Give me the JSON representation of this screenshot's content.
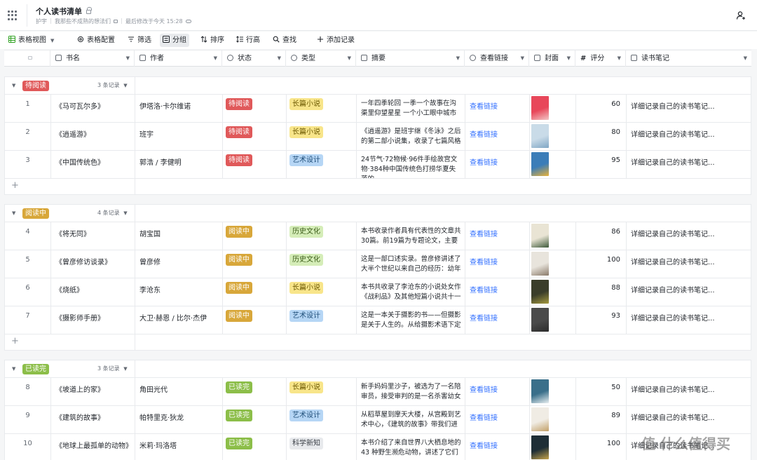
{
  "header": {
    "title": "个人读书清单",
    "owner": "护宇",
    "description": "我那些不成熟的想法们",
    "saved": "最后修改于今天 15:28"
  },
  "toolbar": {
    "view": "表格视图",
    "config": "表格配置",
    "filter": "筛选",
    "group": "分组",
    "sort": "排序",
    "row_height": "行高",
    "search": "查找",
    "add": "添加记录"
  },
  "columns": {
    "name": "书名",
    "author": "作者",
    "status": "状态",
    "type": "类型",
    "summary": "摘要",
    "link": "查看链接",
    "cover": "封面",
    "score": "评分",
    "notes": "读书笔记"
  },
  "groups": [
    {
      "label": "待阅读",
      "count": "3 条记录",
      "rows": [
        {
          "num": "1",
          "name": "《马可瓦尔多》",
          "author": "伊塔洛·卡尔维诺",
          "status": "待阅读",
          "type": "长篇小说",
          "summary": "一年四季轮回 一季一个故事在沟渠里仰望星星 一个小工眼中城市",
          "link": "查看链接",
          "score": "60",
          "notes": "详细记录自己的读书笔记..."
        },
        {
          "num": "2",
          "name": "《逍遥游》",
          "author": "班宇",
          "status": "待阅读",
          "type": "长篇小说",
          "summary": "《逍遥游》是班宇继《冬泳》之后的第二部小说集，收录了七篇风格",
          "link": "查看链接",
          "score": "80",
          "notes": "详细记录自己的读书笔记..."
        },
        {
          "num": "3",
          "name": "《中国传统色》",
          "author": "郭浩 / 李健明",
          "status": "待阅读",
          "type": "艺术设计",
          "summary": "24节气·72物候·96件手绘故宫文物·384种中国传统色打捞华夏失落的",
          "link": "查看链接",
          "score": "95",
          "notes": "详细记录自己的读书笔记..."
        }
      ]
    },
    {
      "label": "阅读中",
      "count": "4 条记录",
      "rows": [
        {
          "num": "4",
          "name": "《将无同》",
          "author": "胡宝国",
          "status": "阅读中",
          "type": "历史文化",
          "summary": "本书收录作者具有代表性的文章共30篇。前19篇为专题论文，主要",
          "link": "查看链接",
          "score": "86",
          "notes": "详细记录自己的读书笔记..."
        },
        {
          "num": "5",
          "name": "《曾彦修访谈录》",
          "author": "曾彦修",
          "status": "阅读中",
          "type": "历史文化",
          "summary": "这是一部口述实录。曾彦修讲述了大半个世纪以来自己的经历：幼年",
          "link": "查看链接",
          "score": "100",
          "notes": "详细记录自己的读书笔记..."
        },
        {
          "num": "6",
          "name": "《烧纸》",
          "author": "李沧东",
          "status": "阅读中",
          "type": "长篇小说",
          "summary": "本书共收录了李沧东的小说处女作《战利品》及其他短篇小说共十一",
          "link": "查看链接",
          "score": "88",
          "notes": "详细记录自己的读书笔记..."
        },
        {
          "num": "7",
          "name": "《摄影师手册》",
          "author": "大卫·赫恩 / 比尔·杰伊",
          "status": "阅读中",
          "type": "艺术设计",
          "summary": "这是一本关于摄影的书——但摄影是关于人生的。从给摄影术语下定",
          "link": "查看链接",
          "score": "93",
          "notes": "详细记录自己的读书笔记..."
        }
      ]
    },
    {
      "label": "已读完",
      "count": "3 条记录",
      "rows": [
        {
          "num": "8",
          "name": "《坡道上的家》",
          "author": "角田光代",
          "status": "已读完",
          "type": "长篇小说",
          "summary": "新手妈妈里沙子，被选为了一名陪审员，接受审判的是一名杀害幼女",
          "link": "查看链接",
          "score": "50",
          "notes": "详细记录自己的读书笔记..."
        },
        {
          "num": "9",
          "name": "《建筑的故事》",
          "author": "帕特里克·狄龙",
          "status": "已读完",
          "type": "艺术设计",
          "summary": "从稻草屋到摩天大楼，从宫殿到艺术中心，《建筑的故事》带我们进",
          "link": "查看链接",
          "score": "89",
          "notes": "详细记录自己的读书笔记..."
        },
        {
          "num": "10",
          "name": "《地球上最孤单的动物》",
          "author": "米莉·玛洛塔",
          "status": "已读完",
          "type": "科学新知",
          "summary": "本书介绍了来自世界八大栖息地的43 种野生濒危动物，讲述了它们",
          "link": "查看链接",
          "score": "100",
          "notes": "详细记录自己的读书笔记..."
        }
      ]
    }
  ],
  "watermark": "值 什么值得买",
  "colors": {
    "status_todo": "#e0595a",
    "status_reading": "#d8a73a",
    "status_done": "#8cbe49",
    "link": "#3370ff",
    "covers": [
      [
        "#e8475a",
        "#f2c6c6"
      ],
      [
        "#c9dbe8",
        "#7fa6c4"
      ],
      [
        "#3b7db8",
        "#e8b23a"
      ],
      [
        "#e9e4d4",
        "#3e5a3a"
      ],
      [
        "#e8e4dc",
        "#8a7a6a"
      ],
      [
        "#3a3d2a",
        "#a59a3e"
      ],
      [
        "#4a4a4a",
        "#2b2b2b"
      ],
      [
        "#3a6f8a",
        "#e8eef0"
      ],
      [
        "#f0ece4",
        "#c2a068"
      ],
      [
        "#1e2e36",
        "#c4a24a"
      ]
    ]
  }
}
